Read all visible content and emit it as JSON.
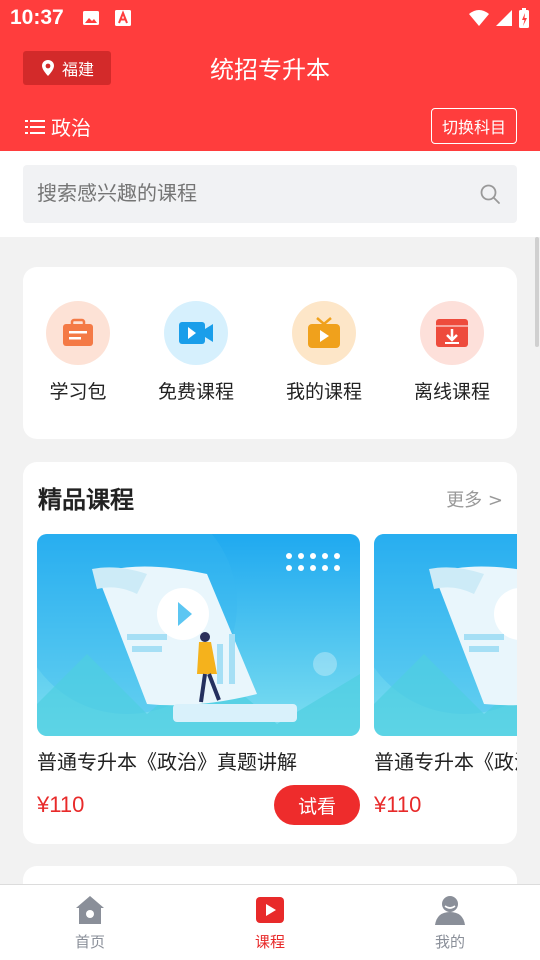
{
  "status_bar": {
    "time": "10:37"
  },
  "header": {
    "location": "福建",
    "title": "统招专升本",
    "subject": "政治",
    "switch_label": "切换科目"
  },
  "search": {
    "placeholder": "搜索感兴趣的课程"
  },
  "quick_entries": [
    {
      "label": "学习包",
      "icon": "study-pack-icon",
      "color": "#f47a46"
    },
    {
      "label": "免费课程",
      "icon": "video-camera-icon",
      "color": "#1a9eea"
    },
    {
      "label": "我的课程",
      "icon": "tv-play-icon",
      "color": "#f0a11c"
    },
    {
      "label": "离线课程",
      "icon": "download-icon",
      "color": "#ee4b3c"
    }
  ],
  "premium": {
    "title": "精品课程",
    "more": "更多 >",
    "courses": [
      {
        "name": "普通专升本《政治》真题讲解",
        "price": "¥110",
        "trial": "试看"
      },
      {
        "name": "普通专升本《政治》真题讲解",
        "price": "¥110"
      }
    ]
  },
  "tabbar": {
    "items": [
      {
        "label": "首页",
        "icon": "home-icon"
      },
      {
        "label": "课程",
        "icon": "course-play-icon"
      },
      {
        "label": "我的",
        "icon": "profile-icon"
      }
    ],
    "active_color": "#e82a2a"
  },
  "colors": {
    "brand": "#ff3d3d",
    "price": "#e82a2a"
  }
}
